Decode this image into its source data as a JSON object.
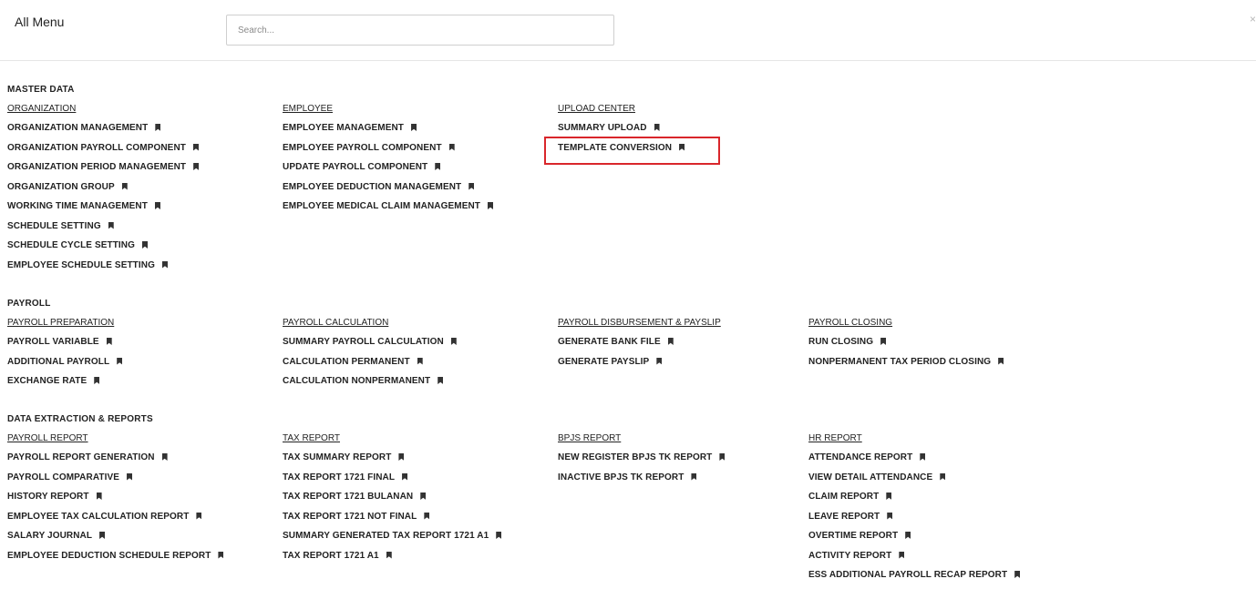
{
  "header": {
    "title": "All Menu",
    "search_placeholder": "Search...",
    "close_glyph": "×"
  },
  "icons": {
    "bookmark": "bookmark-icon",
    "close": "close-icon"
  },
  "colors": {
    "highlight": "#d9262b"
  },
  "sections": [
    {
      "title": "MASTER DATA",
      "groups": [
        {
          "title": "ORGANIZATION",
          "items": [
            "ORGANIZATION MANAGEMENT",
            "ORGANIZATION PAYROLL COMPONENT",
            "ORGANIZATION PERIOD MANAGEMENT",
            "ORGANIZATION GROUP",
            "WORKING TIME MANAGEMENT",
            "SCHEDULE SETTING",
            "SCHEDULE CYCLE SETTING",
            "EMPLOYEE SCHEDULE SETTING"
          ]
        },
        {
          "title": "EMPLOYEE",
          "items": [
            "EMPLOYEE MANAGEMENT",
            "EMPLOYEE PAYROLL COMPONENT",
            "UPDATE PAYROLL COMPONENT",
            "EMPLOYEE DEDUCTION MANAGEMENT",
            "EMPLOYEE MEDICAL CLAIM MANAGEMENT"
          ]
        },
        {
          "title": "UPLOAD CENTER",
          "items": [
            "SUMMARY UPLOAD",
            "TEMPLATE CONVERSION"
          ]
        }
      ]
    },
    {
      "title": "PAYROLL",
      "groups": [
        {
          "title": "PAYROLL PREPARATION",
          "items": [
            "PAYROLL VARIABLE",
            "ADDITIONAL PAYROLL",
            "EXCHANGE RATE"
          ]
        },
        {
          "title": "PAYROLL CALCULATION",
          "items": [
            "SUMMARY PAYROLL CALCULATION",
            "CALCULATION PERMANENT",
            "CALCULATION NONPERMANENT"
          ]
        },
        {
          "title": "PAYROLL DISBURSEMENT & PAYSLIP",
          "items": [
            "GENERATE BANK FILE",
            "GENERATE PAYSLIP"
          ]
        },
        {
          "title": "PAYROLL CLOSING",
          "items": [
            "RUN CLOSING",
            "NONPERMANENT TAX PERIOD CLOSING"
          ]
        }
      ]
    },
    {
      "title": "DATA EXTRACTION & REPORTS",
      "groups": [
        {
          "title": "PAYROLL REPORT",
          "items": [
            "PAYROLL REPORT GENERATION",
            "PAYROLL COMPARATIVE",
            "HISTORY REPORT",
            "EMPLOYEE TAX CALCULATION REPORT",
            "SALARY JOURNAL",
            "EMPLOYEE DEDUCTION SCHEDULE REPORT"
          ]
        },
        {
          "title": "TAX REPORT",
          "items": [
            "TAX SUMMARY REPORT",
            "TAX REPORT 1721 FINAL",
            "TAX REPORT 1721 BULANAN",
            "TAX REPORT 1721 NOT FINAL",
            "SUMMARY GENERATED TAX REPORT 1721 A1",
            "TAX REPORT 1721 A1"
          ]
        },
        {
          "title": "BPJS REPORT",
          "items": [
            "NEW REGISTER BPJS TK REPORT",
            "INACTIVE BPJS TK REPORT"
          ]
        },
        {
          "title": "HR REPORT",
          "items": [
            "ATTENDANCE REPORT",
            "VIEW DETAIL ATTENDANCE",
            "CLAIM REPORT",
            "LEAVE REPORT",
            "OVERTIME REPORT",
            "ACTIVITY REPORT",
            "ESS ADDITIONAL PAYROLL RECAP REPORT"
          ]
        }
      ]
    }
  ]
}
